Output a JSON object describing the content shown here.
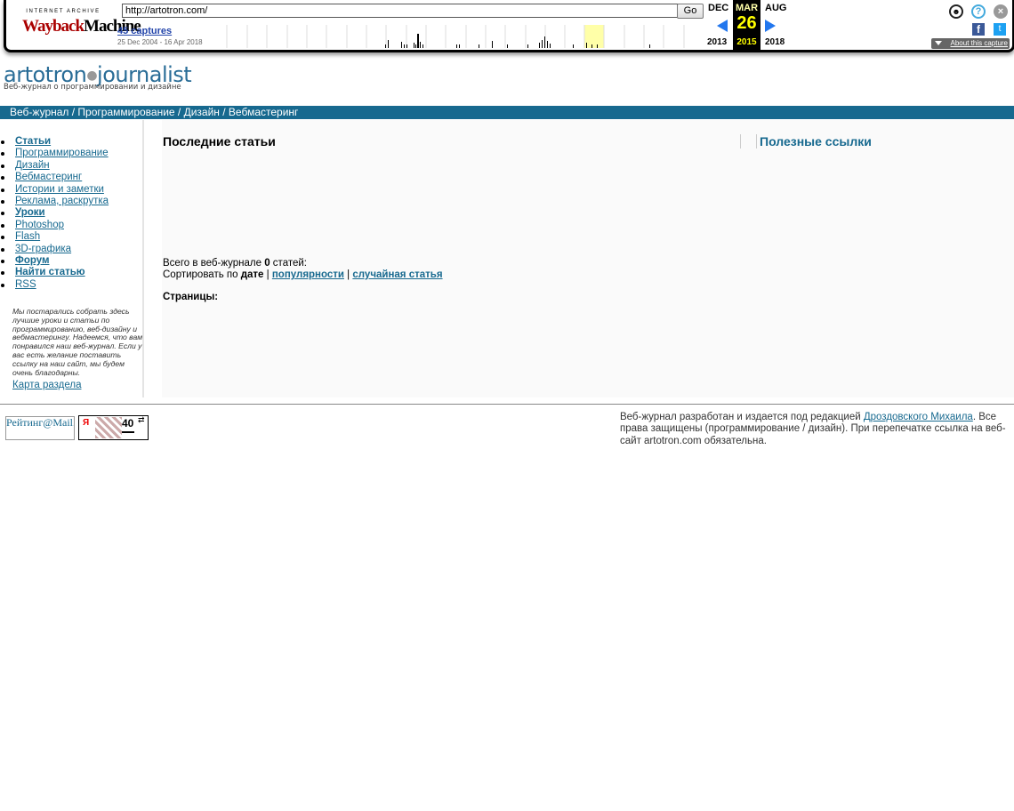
{
  "wayback": {
    "logo_top": "INTERNET ARCHIVE",
    "logo_main_w": "Wayback",
    "logo_main_rest": "Machine",
    "url": "http://artotron.com/",
    "go_label": "Go",
    "captures": "45 captures",
    "range": "25 Dec 2004 - 16 Apr 2018",
    "prev_month": "DEC",
    "prev_year": "2013",
    "cur_month": "MAR",
    "cur_day": "26",
    "cur_year": "2015",
    "next_month": "AUG",
    "next_year": "2018",
    "about": "About this capture",
    "fb": "f",
    "tw": "t",
    "help": "?",
    "close": "×",
    "user": "☻"
  },
  "site": {
    "logo_a": "artotron",
    "logo_dot": "●",
    "logo_b": "journalist",
    "tagline": "Веб-журнал о программировании и дизайне",
    "nav": "Веб-журнал / Программирование / Дизайн / Вебмастеринг"
  },
  "sidebar": {
    "items": [
      {
        "label": "Статьи",
        "bold": true
      },
      {
        "label": "Программирование",
        "bold": false
      },
      {
        "label": "Дизайн",
        "bold": false
      },
      {
        "label": "Вебмастеринг",
        "bold": false
      },
      {
        "label": "Истории и заметки",
        "bold": false
      },
      {
        "label": "Реклама, раскрутка",
        "bold": false
      },
      {
        "label": "Уроки",
        "bold": true
      },
      {
        "label": "Photoshop",
        "bold": false
      },
      {
        "label": "Flash",
        "bold": false
      },
      {
        "label": "3D-графика",
        "bold": false
      },
      {
        "label": "Форум",
        "bold": true
      },
      {
        "label": "Найти статью",
        "bold": true
      },
      {
        "label": "RSS",
        "bold": false
      }
    ],
    "note": "Мы постарались собрать здесь лучшие уроки и статьи по программированию, веб-дизайну и вебмастерингу. Надеемся, что вам понравился наш веб-журнал. Если у вас есть желание поставить ссылку на наш сайт, мы будем очень благодарны.",
    "sitemap": "Карта раздела"
  },
  "main": {
    "title": "Последние статьи",
    "links_title": "Полезные ссылки",
    "total_prefix": "Всего в веб-журнале ",
    "total_count": "0",
    "total_suffix": " статей:",
    "sort_prefix": "Сортировать по ",
    "sort_date": "дате",
    "sort_sep": " | ",
    "sort_popular": "популярности",
    "sort_random": "случайная статья",
    "pages": "Страницы:"
  },
  "footer": {
    "counter1_alt": "Рейтинг@Mail.ru",
    "counter2_ya": "Я",
    "counter2_num": "40",
    "counter2_sym": "⇄",
    "copy_before": "Веб-журнал разработан и издается под редакцией ",
    "copy_link": "Дроздовского Михаила",
    "copy_after": ". Все права защищены (программирование / дизайн). При перепечатке ссылка на веб-сайт artotron.com обязательна."
  },
  "colors": {
    "brand": "#17698f",
    "wayback_arrow": "#2277ee",
    "current_highlight": "#ffff00"
  }
}
